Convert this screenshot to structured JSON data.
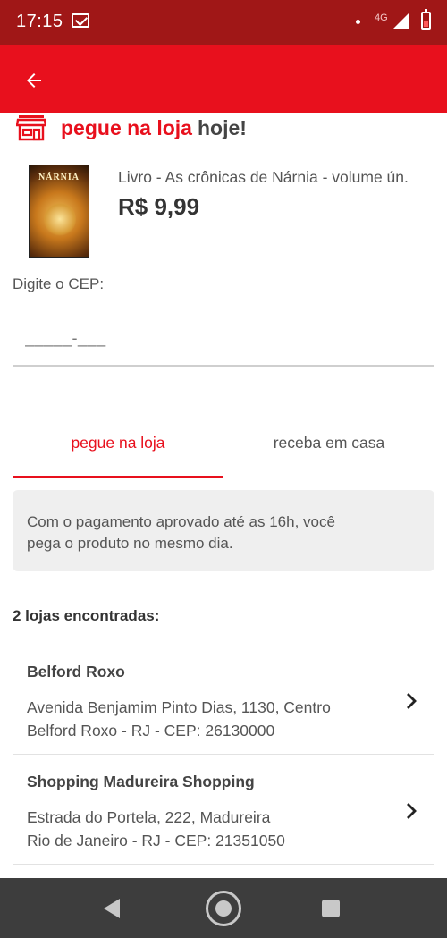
{
  "status_bar": {
    "time": "17:15",
    "network": "4G",
    "icons": [
      "mail-icon",
      "dot-icon",
      "signal-icon",
      "battery-icon"
    ]
  },
  "app_bar": {
    "background": "#e8101d",
    "back_icon": "arrow-left-icon"
  },
  "header": {
    "icon": "store-icon",
    "highlight": "pegue na loja",
    "rest": "hoje!"
  },
  "product": {
    "cover_title": "NÁRNIA",
    "name": "Livro - As crônicas de Nárnia - volume ún.",
    "price": "R$ 9,99"
  },
  "cep": {
    "label": "Digite o CEP:",
    "placeholder": "_____-___",
    "value": ""
  },
  "tabs": [
    {
      "label": "pegue na loja",
      "active": true
    },
    {
      "label": "receba em casa",
      "active": false
    }
  ],
  "info": {
    "line1": "Com o pagamento aprovado até as 16h, você",
    "line2": "pega o produto no mesmo dia."
  },
  "stores": {
    "count_label": "2 lojas encontradas:",
    "items": [
      {
        "name": "Belford Roxo",
        "address_line1": "Avenida Benjamim Pinto Dias, 1130, Centro",
        "address_line2": "Belford Roxo - RJ - CEP: 26130000"
      },
      {
        "name": "Shopping Madureira Shopping",
        "address_line1": "Estrada do Portela, 222, Madureira",
        "address_line2": "Rio de Janeiro - RJ - CEP: 21351050"
      }
    ]
  },
  "colors": {
    "accent": "#e8101d",
    "status_bar": "#a01717",
    "nav_bar": "#3d3d3d"
  },
  "nav_bar": {
    "icons": [
      "nav-back-icon",
      "nav-home-icon",
      "nav-recents-icon"
    ]
  }
}
